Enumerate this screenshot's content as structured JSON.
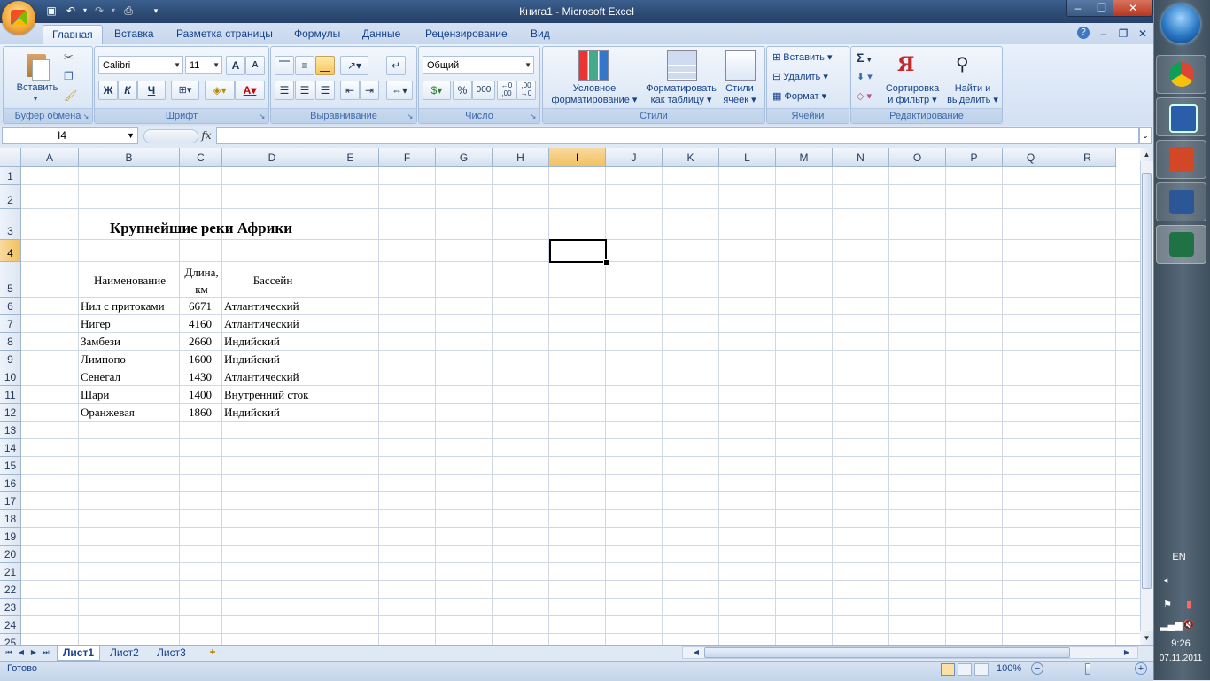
{
  "window": {
    "title": "Книга1 - Microsoft Excel",
    "min_glyph": "–",
    "max_glyph": "❐",
    "close_glyph": "✕"
  },
  "quick_access": [
    {
      "name": "save-icon",
      "glyph": "💾"
    },
    {
      "name": "undo-icon",
      "glyph": "↶"
    },
    {
      "name": "redo-icon",
      "glyph": "↷"
    },
    {
      "name": "print-icon",
      "glyph": "⎙"
    },
    {
      "name": "customize-icon",
      "glyph": "▾"
    }
  ],
  "ribbon_tabs": [
    "Главная",
    "Вставка",
    "Разметка страницы",
    "Формулы",
    "Данные",
    "Рецензирование",
    "Вид"
  ],
  "ribbon": {
    "clipboard": {
      "label": "Буфер обмена",
      "paste": "Вставить"
    },
    "font": {
      "label": "Шрифт",
      "font_name": "Calibri",
      "font_size": "11",
      "bold": "Ж",
      "italic": "К",
      "underline": "Ч",
      "grow": "A",
      "shrink": "A",
      "font_color": "A"
    },
    "alignment": {
      "label": "Выравнивание"
    },
    "number": {
      "label": "Число",
      "format": "Общий",
      "percent": "%",
      "thousands": "000",
      "inc_dec": ",0 ,00",
      "dec_dec": ",00 ,0"
    },
    "styles": {
      "label": "Стили",
      "conditional": "Условное\nформатирование",
      "conditional_l1": "Условное",
      "conditional_l2": "форматирование",
      "as_table_l1": "Форматировать",
      "as_table_l2": "как таблицу",
      "cell_styles_l1": "Стили",
      "cell_styles_l2": "ячеек"
    },
    "cells": {
      "label": "Ячейки",
      "insert": "Вставить",
      "delete": "Удалить",
      "format": "Формат"
    },
    "editing": {
      "label": "Редактирование",
      "sigma": "Σ",
      "sort_l1": "Сортировка",
      "sort_l2": "и фильтр",
      "find_l1": "Найти и",
      "find_l2": "выделить"
    }
  },
  "formula_bar": {
    "name_box": "I4",
    "fx": "fx",
    "value": ""
  },
  "columns": [
    "A",
    "B",
    "C",
    "D",
    "E",
    "F",
    "G",
    "H",
    "I",
    "J",
    "K",
    "L",
    "M",
    "N",
    "O",
    "P",
    "Q",
    "R"
  ],
  "rows": [
    "1",
    "2",
    "3",
    "4",
    "5",
    "6",
    "7",
    "8",
    "9",
    "10",
    "11",
    "12",
    "13",
    "14",
    "15",
    "16",
    "17",
    "18",
    "19",
    "20",
    "21",
    "22",
    "23",
    "24",
    "25"
  ],
  "sheet": {
    "title": "Крупнейшие реки Африки",
    "headers": {
      "name": "Наименование",
      "length_l1": "Длина,",
      "length_l2": "км",
      "basin": "Бассейн"
    },
    "table": [
      {
        "name": "Нил с притоками",
        "length": "6671",
        "basin": "Атлантический"
      },
      {
        "name": "Нигер",
        "length": "4160",
        "basin": "Атлантический"
      },
      {
        "name": "Замбези",
        "length": "2660",
        "basin": "Индийский"
      },
      {
        "name": "Лимпопо",
        "length": "1600",
        "basin": "Индийский"
      },
      {
        "name": "Сенегал",
        "length": "1430",
        "basin": "Атлантический"
      },
      {
        "name": "Шари",
        "length": "1400",
        "basin": "Внутренний сток"
      },
      {
        "name": "Оранжевая",
        "length": "1860",
        "basin": "Индийский"
      }
    ]
  },
  "sheet_tabs": [
    "Лист1",
    "Лист2",
    "Лист3"
  ],
  "status": {
    "ready": "Готово",
    "zoom": "100%"
  },
  "taskbar": {
    "lang": "EN",
    "time": "9:26",
    "date": "07.11.2011"
  }
}
